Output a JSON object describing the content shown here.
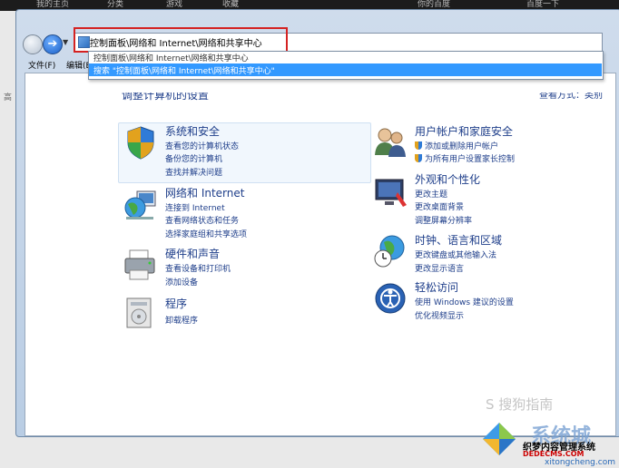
{
  "taskbar": {
    "items": [
      "我的主页",
      "分类",
      "游戏",
      "收藏",
      "你的百度",
      "百度一下"
    ]
  },
  "address_bar": {
    "path": "控制面板\\网络和 Internet\\网络和共享中心"
  },
  "autocomplete": {
    "item1": "控制面板\\网络和 Internet\\网络和共享中心",
    "item2": "搜索 \"控制面板\\网络和 Internet\\网络和共享中心\""
  },
  "menu": {
    "file": "文件(F)",
    "edit": "编辑(E)"
  },
  "side_char": "高",
  "heading_partial": "调整计算机的设置",
  "viewby_partial": "查看方式：类别",
  "categories": {
    "system_security": {
      "title": "系统和安全",
      "links": [
        "查看您的计算机状态",
        "备份您的计算机",
        "查找并解决问题"
      ]
    },
    "network_internet": {
      "title": "网络和 Internet",
      "links": [
        "连接到 Internet",
        "查看网络状态和任务",
        "选择家庭组和共享选项"
      ]
    },
    "hardware_sound": {
      "title": "硬件和声音",
      "links": [
        "查看设备和打印机",
        "添加设备"
      ]
    },
    "programs": {
      "title": "程序",
      "links": [
        "卸载程序"
      ]
    },
    "user_accounts": {
      "title": "用户帐户和家庭安全",
      "links": [
        "添加或删除用户帐户",
        "为所有用户设置家长控制"
      ]
    },
    "appearance": {
      "title": "外观和个性化",
      "links": [
        "更改主题",
        "更改桌面背景",
        "调整屏幕分辨率"
      ]
    },
    "clock_region": {
      "title": "时钟、语言和区域",
      "links": [
        "更改键盘或其他输入法",
        "更改显示语言"
      ]
    },
    "ease_access": {
      "title": "轻松访问",
      "links": [
        "使用 Windows 建议的设置",
        "优化视频显示"
      ]
    }
  },
  "watermark": {
    "sogou": "S 搜狗指南",
    "system": "系统城",
    "site_cn": "织梦内容管理系统",
    "site_en": "DEDECMS.COM",
    "site_url": "xitongcheng.com"
  }
}
